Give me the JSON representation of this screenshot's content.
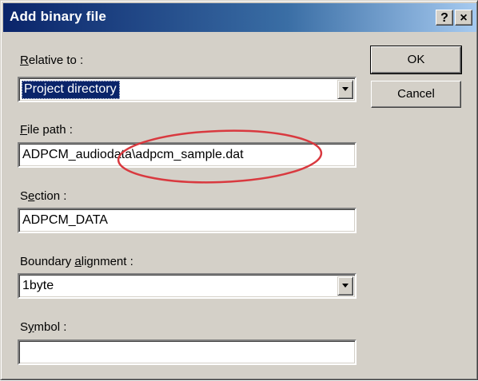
{
  "window": {
    "title": "Add binary file",
    "help_label": "?",
    "close_label": "×"
  },
  "relative_to": {
    "label_key": "R",
    "label_rest": "elative to :",
    "value": "Project directory"
  },
  "file_path": {
    "label_key": "F",
    "label_rest": "ile path :",
    "value": "ADPCM_audiodata\\adpcm_sample.dat"
  },
  "section": {
    "label_pre": "S",
    "label_key": "e",
    "label_rest": "ction :",
    "value": "ADPCM_DATA"
  },
  "boundary": {
    "label_pre": "Boundary ",
    "label_key": "a",
    "label_rest": "lignment :",
    "value": "1byte"
  },
  "symbol": {
    "label_pre": "S",
    "label_key": "y",
    "label_rest": "mbol :",
    "value": ""
  },
  "buttons": {
    "ok": "OK",
    "cancel": "Cancel"
  },
  "colors": {
    "title_bar": "#0a246a",
    "dialog_face": "#d4d0c8",
    "selection": "#0a246a",
    "annotation": "#d9393f"
  },
  "icons": [
    "help-icon",
    "close-icon",
    "dropdown-arrow-icon"
  ]
}
